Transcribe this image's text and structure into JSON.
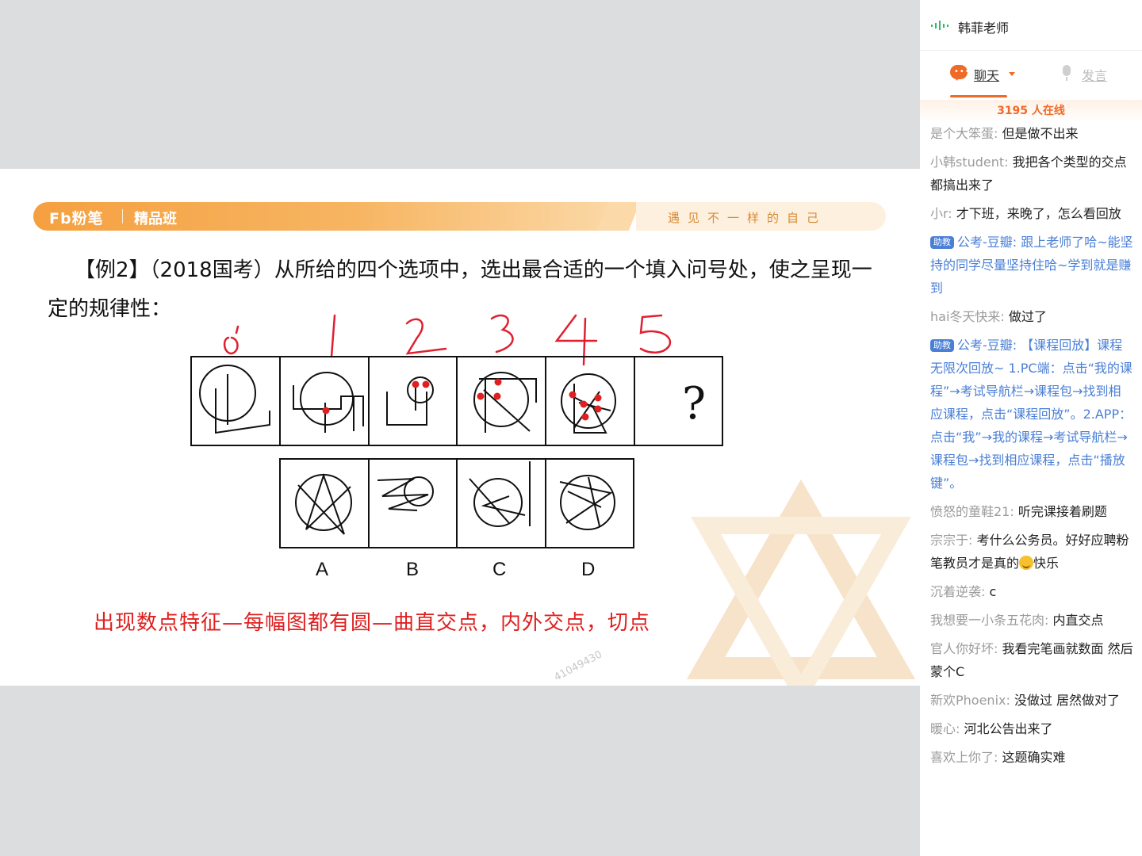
{
  "slide": {
    "banner": {
      "logo": "Fb粉笔",
      "product": "精品班",
      "slogan": "遇见不一样的自己"
    },
    "question": "【例2】（2018国考）从所给的四个选项中，选出最合适的一个填入问号处，使之呈现一定的规律性：",
    "annotations": {
      "numbers": [
        "0",
        "1",
        "2",
        "3",
        "4",
        "5"
      ],
      "question_mark": "?",
      "options": [
        "A",
        "B",
        "C",
        "D"
      ]
    },
    "caption": "出现数点特征—每幅图都有圆—曲直交点，内外交点，切点",
    "watermark": "41049430"
  },
  "sidebar": {
    "teacher": "韩菲老师",
    "tabs": {
      "chat": "聊天",
      "speak": "发言"
    },
    "online": "3195 人在线",
    "messages": [
      {
        "user": "是个大笨蛋:",
        "text": "但是做不出来",
        "assistant": false
      },
      {
        "user": "小韩student:",
        "text": "我把各个类型的交点都搞出来了",
        "assistant": false
      },
      {
        "user": "小r:",
        "text": "才下班，来晚了，怎么看回放",
        "assistant": false
      },
      {
        "user": "公考-豆瓣:",
        "text": "跟上老师了哈~能坚持的同学尽量坚持住哈~学到就是赚到",
        "assistant": true
      },
      {
        "user": "hai冬天快来:",
        "text": "做过了",
        "assistant": false
      },
      {
        "user": "公考-豆瓣:",
        "text": "【课程回放】课程无限次回放~ 1.PC端：点击“我的课程”→考试导航栏→课程包→找到相应课程，点击“课程回放”。2.APP：点击“我”→我的课程→考试导航栏→课程包→找到相应课程，点击“播放键”。",
        "assistant": true
      },
      {
        "user": "愤怒的童鞋21:",
        "text": "听完课接着刷题",
        "assistant": false
      },
      {
        "user": "宗宗于:",
        "text": "考什么公务员。好好应聘粉笔教员才是真的",
        "suffix": "快乐",
        "emoji": true,
        "assistant": false
      },
      {
        "user": "沉着逆袭:",
        "text": "c",
        "assistant": false
      },
      {
        "user": "我想要一小条五花肉:",
        "text": "内直交点",
        "assistant": false
      },
      {
        "user": "官人你好坏:",
        "text": "我看完笔画就数面 然后蒙个C",
        "assistant": false
      },
      {
        "user": "新欢Phoenix:",
        "text": "没做过 居然做对了",
        "assistant": false
      },
      {
        "user": "暖心:",
        "text": "河北公告出来了",
        "assistant": false
      },
      {
        "user": "喜欢上你了:",
        "text": "这题确实难",
        "assistant": false
      }
    ],
    "assistant_badge": "助教"
  },
  "colors": {
    "accent": "#f06a27",
    "caption": "#e02020",
    "assistant": "#4a7fd6",
    "banner": "#f5a040"
  }
}
